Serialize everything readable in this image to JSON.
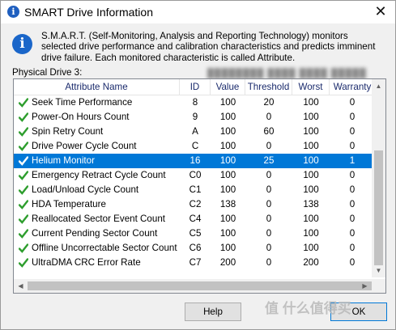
{
  "window": {
    "title": "SMART Drive Information",
    "close_glyph": "✕",
    "title_icon": "info-icon"
  },
  "description": "S.M.A.R.T. (Self-Monitoring, Analysis and Reporting Technology) monitors selected drive performance and calibration characteristics and predicts imminent drive failure. Each monitored characteristic is called Attribute.",
  "physical_drive": {
    "label": "Physical Drive 3:",
    "value": "████████ ████ ████ █████"
  },
  "table": {
    "columns": [
      "Attribute Name",
      "ID",
      "Value",
      "Threshold",
      "Worst",
      "Warranty"
    ],
    "selected_index": 4,
    "rows": [
      {
        "name": "Seek Time Performance",
        "id": "8",
        "value": "100",
        "threshold": "20",
        "worst": "100",
        "warranty": "0"
      },
      {
        "name": "Power-On Hours Count",
        "id": "9",
        "value": "100",
        "threshold": "0",
        "worst": "100",
        "warranty": "0"
      },
      {
        "name": "Spin Retry Count",
        "id": "A",
        "value": "100",
        "threshold": "60",
        "worst": "100",
        "warranty": "0"
      },
      {
        "name": "Drive Power Cycle Count",
        "id": "C",
        "value": "100",
        "threshold": "0",
        "worst": "100",
        "warranty": "0"
      },
      {
        "name": "Helium Monitor",
        "id": "16",
        "value": "100",
        "threshold": "25",
        "worst": "100",
        "warranty": "1"
      },
      {
        "name": "Emergency Retract Cycle Count",
        "id": "C0",
        "value": "100",
        "threshold": "0",
        "worst": "100",
        "warranty": "0"
      },
      {
        "name": "Load/Unload Cycle Count",
        "id": "C1",
        "value": "100",
        "threshold": "0",
        "worst": "100",
        "warranty": "0"
      },
      {
        "name": "HDA Temperature",
        "id": "C2",
        "value": "138",
        "threshold": "0",
        "worst": "138",
        "warranty": "0"
      },
      {
        "name": "Reallocated Sector Event Count",
        "id": "C4",
        "value": "100",
        "threshold": "0",
        "worst": "100",
        "warranty": "0"
      },
      {
        "name": "Current Pending Sector Count",
        "id": "C5",
        "value": "100",
        "threshold": "0",
        "worst": "100",
        "warranty": "0"
      },
      {
        "name": "Offline Uncorrectable Sector Count",
        "id": "C6",
        "value": "100",
        "threshold": "0",
        "worst": "100",
        "warranty": "0"
      },
      {
        "name": "UltraDMA CRC Error Rate",
        "id": "C7",
        "value": "200",
        "threshold": "0",
        "worst": "200",
        "warranty": "0"
      }
    ]
  },
  "buttons": {
    "help": "Help",
    "ok": "OK"
  },
  "watermark": "值 什么值得买",
  "colors": {
    "selection": "#0078d7",
    "check": "#2e9e2e",
    "header_text": "#1a2a6c"
  }
}
